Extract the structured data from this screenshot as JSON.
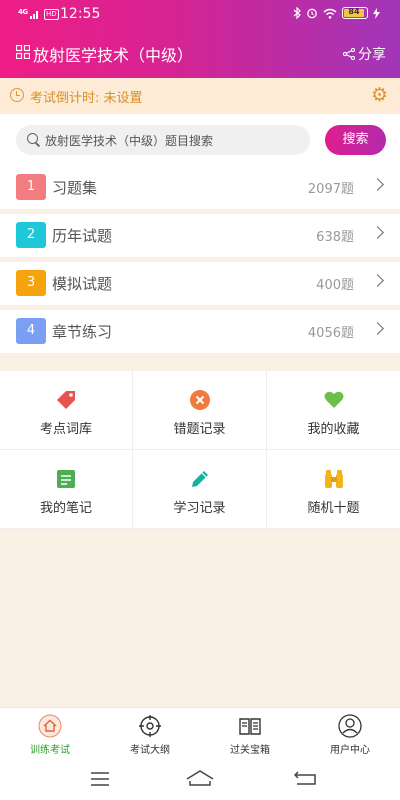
{
  "status_bar": {
    "network": "4G",
    "hd": "HD",
    "time": "12:55",
    "battery_level": "84"
  },
  "header": {
    "title": "放射医学技术（中级）",
    "share_label": "分享"
  },
  "countdown": {
    "text": "考试倒计时: 未设置"
  },
  "search": {
    "placeholder": "放射医学技术（中级）题目搜索",
    "button_label": "搜索"
  },
  "categories": [
    {
      "num": "1",
      "label": "习题集",
      "count": "2097题",
      "color": "#f27c7f"
    },
    {
      "num": "2",
      "label": "历年试题",
      "count": "638题",
      "color": "#1ec8d8"
    },
    {
      "num": "3",
      "label": "模拟试题",
      "count": "400题",
      "color": "#f5a30f"
    },
    {
      "num": "4",
      "label": "章节练习",
      "count": "4056题",
      "color": "#7b9ff2"
    }
  ],
  "tools": [
    {
      "label": "考点词库",
      "icon": "tag-icon",
      "color": "#e8534f"
    },
    {
      "label": "错题记录",
      "icon": "error-circle-icon",
      "color": "#f07a3c"
    },
    {
      "label": "我的收藏",
      "icon": "heart-icon",
      "color": "#6cc04a"
    },
    {
      "label": "我的笔记",
      "icon": "notebook-icon",
      "color": "#4caf50"
    },
    {
      "label": "学习记录",
      "icon": "pencil-icon",
      "color": "#1ab0a0"
    },
    {
      "label": "随机十题",
      "icon": "binoculars-icon",
      "color": "#f2b418"
    }
  ],
  "tabs": [
    {
      "label": "训练考试",
      "icon": "home-icon",
      "active": true
    },
    {
      "label": "考试大纲",
      "icon": "target-icon",
      "active": false
    },
    {
      "label": "过关宝箱",
      "icon": "book-icon",
      "active": false
    },
    {
      "label": "用户中心",
      "icon": "user-icon",
      "active": false
    }
  ],
  "colors": {
    "accent_pink": "#e01d8e",
    "accent_purple": "#a136b8",
    "countdown_text": "#d9902a",
    "active_tab": "#2a9d2a"
  }
}
